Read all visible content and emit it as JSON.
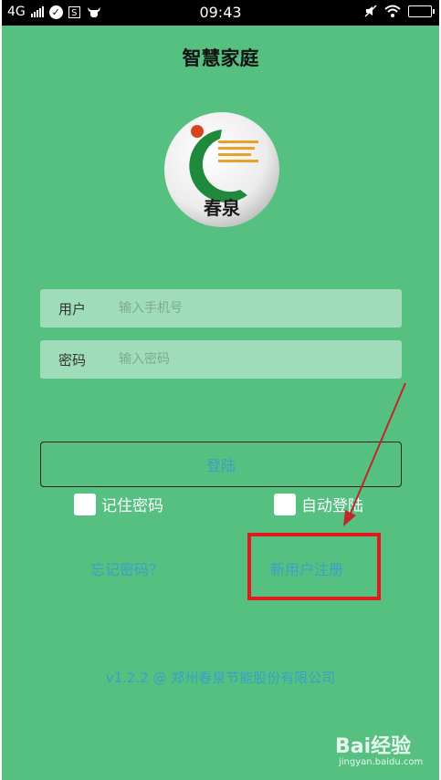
{
  "status_bar": {
    "network": "4G",
    "time": "09:43",
    "sim_icon_text": "S"
  },
  "app": {
    "title": "智慧家庭",
    "logo_text": "春泉"
  },
  "form": {
    "user_label": "用户",
    "user_placeholder": "输入手机号",
    "password_label": "密码",
    "password_placeholder": "输入密码"
  },
  "buttons": {
    "login": "登陆"
  },
  "options": {
    "remember_password": "记住密码",
    "auto_login": "自动登陆"
  },
  "links": {
    "forgot_password": "忘记密码？",
    "register": "新用户注册"
  },
  "footer": {
    "version_company": "v1.2.2 @ 郑州春泉节能股份有限公司"
  },
  "watermark": {
    "brand": "Bai经验",
    "url": "jingyan.baidu.com"
  },
  "colors": {
    "background": "#55c080",
    "field_background": "#9fdcb9",
    "link": "#3aa0c8",
    "highlight": "#e3171c"
  }
}
